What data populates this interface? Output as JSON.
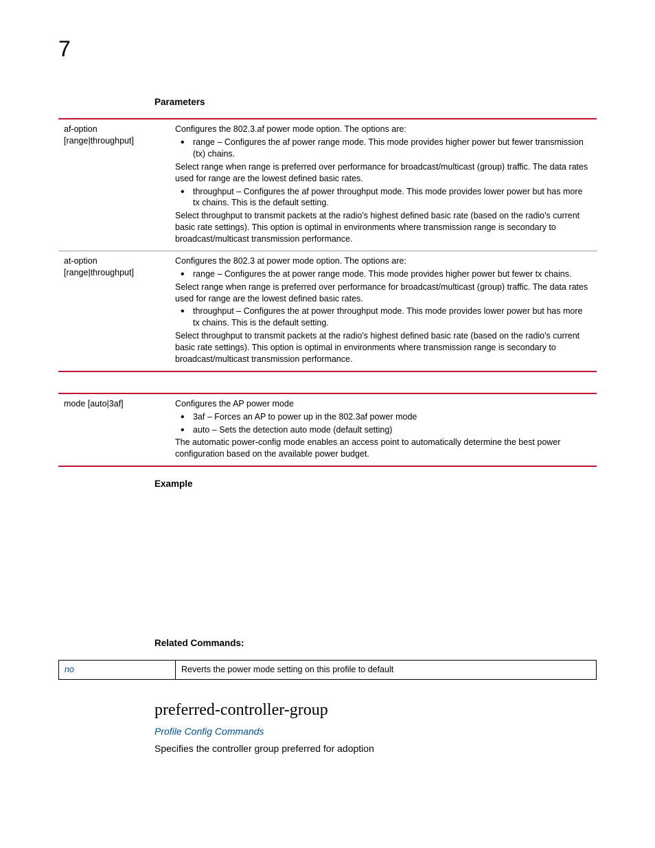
{
  "chapter": "7",
  "parameters_heading": "Parameters",
  "table1": [
    {
      "name_l1": "af-option",
      "name_l2": "[range|throughput]",
      "intro": "Configures the 802.3.af power mode option. The options are:",
      "bullets1": [
        "range – Configures the af power range mode. This mode provides higher power but fewer transmission (tx) chains."
      ],
      "mid1": "Select range when range is preferred over performance for broadcast/multicast (group) traffic. The data rates used for range are the lowest defined basic rates.",
      "bullets2": [
        "throughput – Configures the af power throughput mode. This mode provides lower power but has more tx chains. This is the default setting."
      ],
      "mid2": "Select throughput to transmit packets at the radio's highest defined basic rate (based on the radio's current basic rate settings). This option is optimal in environments where transmission range is secondary to broadcast/multicast transmission performance."
    },
    {
      "name_l1": "at-option",
      "name_l2": "[range|throughput]",
      "intro": "Configures the 802.3 at power mode option. The options are:",
      "bullets1": [
        "range – Configures the at power range mode. This mode provides higher power but fewer tx chains."
      ],
      "mid1": "Select range when range is preferred over performance for broadcast/multicast (group) traffic. The data rates used for range are the lowest defined basic rates.",
      "bullets2": [
        "throughput – Configures the at power throughput mode. This mode provides lower power but has more tx chains. This is the default setting."
      ],
      "mid2": "Select throughput to transmit packets at the radio's highest defined basic rate (based on the radio's current basic rate settings). This option is optimal in environments where transmission range is secondary to broadcast/multicast transmission performance."
    }
  ],
  "table2": [
    {
      "name_l1": "mode [auto|3af]",
      "intro": "Configures the AP power mode",
      "bullets": [
        "3af – Forces an AP to power up in the 802.3af power mode",
        "auto – Sets the detection auto mode (default setting)"
      ],
      "outro": "The automatic power-config mode enables an access point to automatically determine the best power configuration based on the available power budget."
    }
  ],
  "example_heading": "Example",
  "related_heading": "Related Commands:",
  "related": {
    "name": "no",
    "desc": "Reverts the power mode setting on this profile to default"
  },
  "cmd_title": "preferred-controller-group",
  "cmd_link": "Profile Config Commands",
  "cmd_desc": "Specifies the controller group preferred for adoption"
}
